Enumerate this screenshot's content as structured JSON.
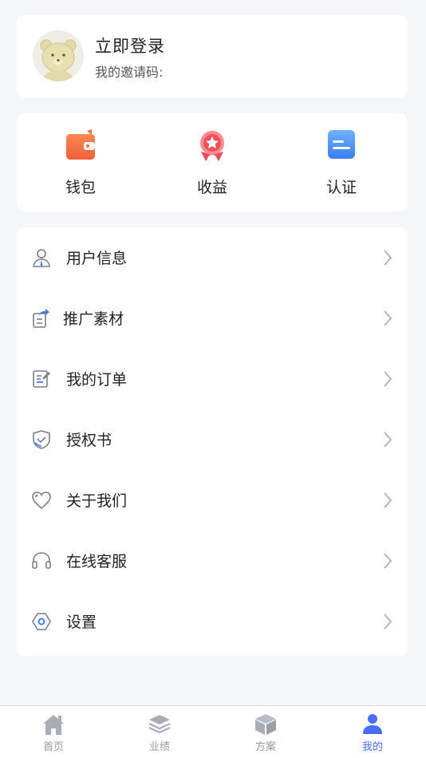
{
  "profile": {
    "login_label": "立即登录",
    "invite_label": "我的邀请码:"
  },
  "quick_actions": [
    {
      "label": "钱包",
      "icon": "wallet-icon"
    },
    {
      "label": "收益",
      "icon": "medal-icon"
    },
    {
      "label": "认证",
      "icon": "certification-icon"
    }
  ],
  "menu": [
    {
      "label": "用户信息",
      "icon": "user-icon"
    },
    {
      "label": "推广素材",
      "icon": "share-material-icon"
    },
    {
      "label": "我的订单",
      "icon": "order-icon"
    },
    {
      "label": "授权书",
      "icon": "shield-icon"
    },
    {
      "label": "关于我们",
      "icon": "heart-icon"
    },
    {
      "label": "在线客服",
      "icon": "headset-icon"
    },
    {
      "label": "设置",
      "icon": "settings-icon"
    }
  ],
  "tabbar": [
    {
      "label": "首页",
      "icon": "home-icon",
      "active": false
    },
    {
      "label": "业绩",
      "icon": "layers-icon",
      "active": false
    },
    {
      "label": "方案",
      "icon": "box-icon",
      "active": false
    },
    {
      "label": "我的",
      "icon": "person-icon",
      "active": true
    }
  ],
  "colors": {
    "accent": "#4a6cf7",
    "background": "#f5f6f8",
    "wallet": "#f9784a",
    "medal": "#f0525a",
    "certification": "#3f8cf6"
  }
}
